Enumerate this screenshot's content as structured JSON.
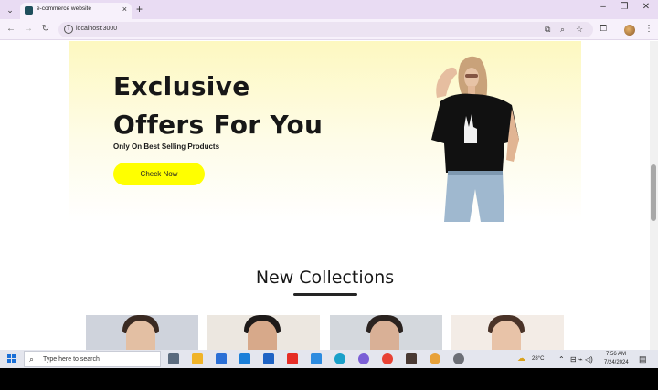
{
  "browser": {
    "tab_title": "e-commerce website",
    "tab_close": "×",
    "new_tab": "+",
    "url": "localhost:3000",
    "window_controls": [
      "–",
      "❐",
      "✕"
    ]
  },
  "hero": {
    "title_line1": "Exclusive",
    "title_line2": "Offers For You",
    "subtitle": "Only On Best Selling Products",
    "cta_label": "Check Now",
    "cta_color": "#ffff00",
    "background_color": "#fdf8c0"
  },
  "collections": {
    "title": "New Collections"
  },
  "taskbar": {
    "search_placeholder": "Type here to search",
    "temperature": "28°C",
    "time": "7:56 AM",
    "date": "7/24/2024"
  }
}
